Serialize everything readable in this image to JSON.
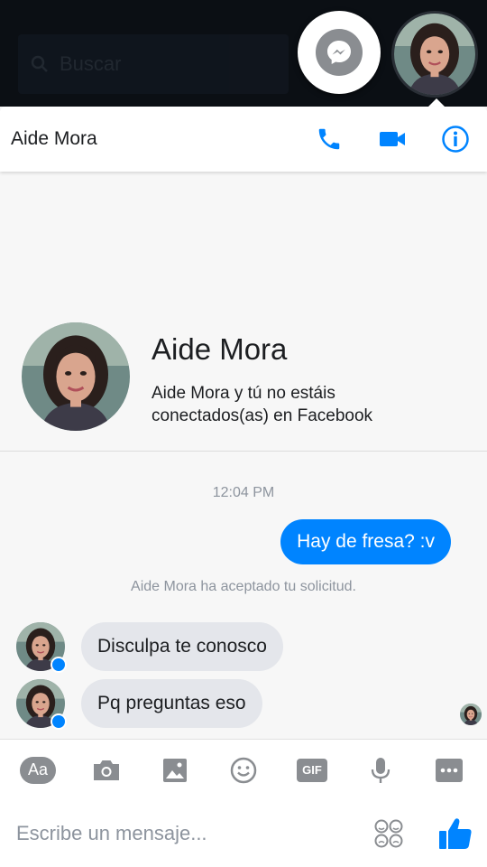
{
  "topbar": {
    "search_placeholder": "Buscar"
  },
  "header": {
    "contact_name": "Aide Mora"
  },
  "profile": {
    "name": "Aide Mora",
    "subtitle": "Aide Mora y tú no estáis conectados(as) en Facebook"
  },
  "conversation": {
    "timestamp": "12:04 PM",
    "outgoing": [
      {
        "text": "Hay de fresa? :v"
      }
    ],
    "system_message": "Aide Mora ha aceptado tu solicitud.",
    "incoming": [
      {
        "text": "Disculpa te conosco"
      },
      {
        "text": "Pq preguntas eso"
      }
    ]
  },
  "composer": {
    "aa_label": "Aa",
    "gif_label": "GIF",
    "placeholder": "Escribe un mensaje..."
  },
  "colors": {
    "accent": "#0084ff",
    "incoming_bubble": "#e4e6eb",
    "icon_gray": "#8a8d91"
  },
  "icons": [
    "search-icon",
    "messenger-icon",
    "phone-icon",
    "video-icon",
    "info-icon",
    "camera-icon",
    "image-icon",
    "emoji-icon",
    "gif-icon",
    "microphone-icon",
    "more-icon",
    "stickers-icon",
    "like-icon"
  ]
}
